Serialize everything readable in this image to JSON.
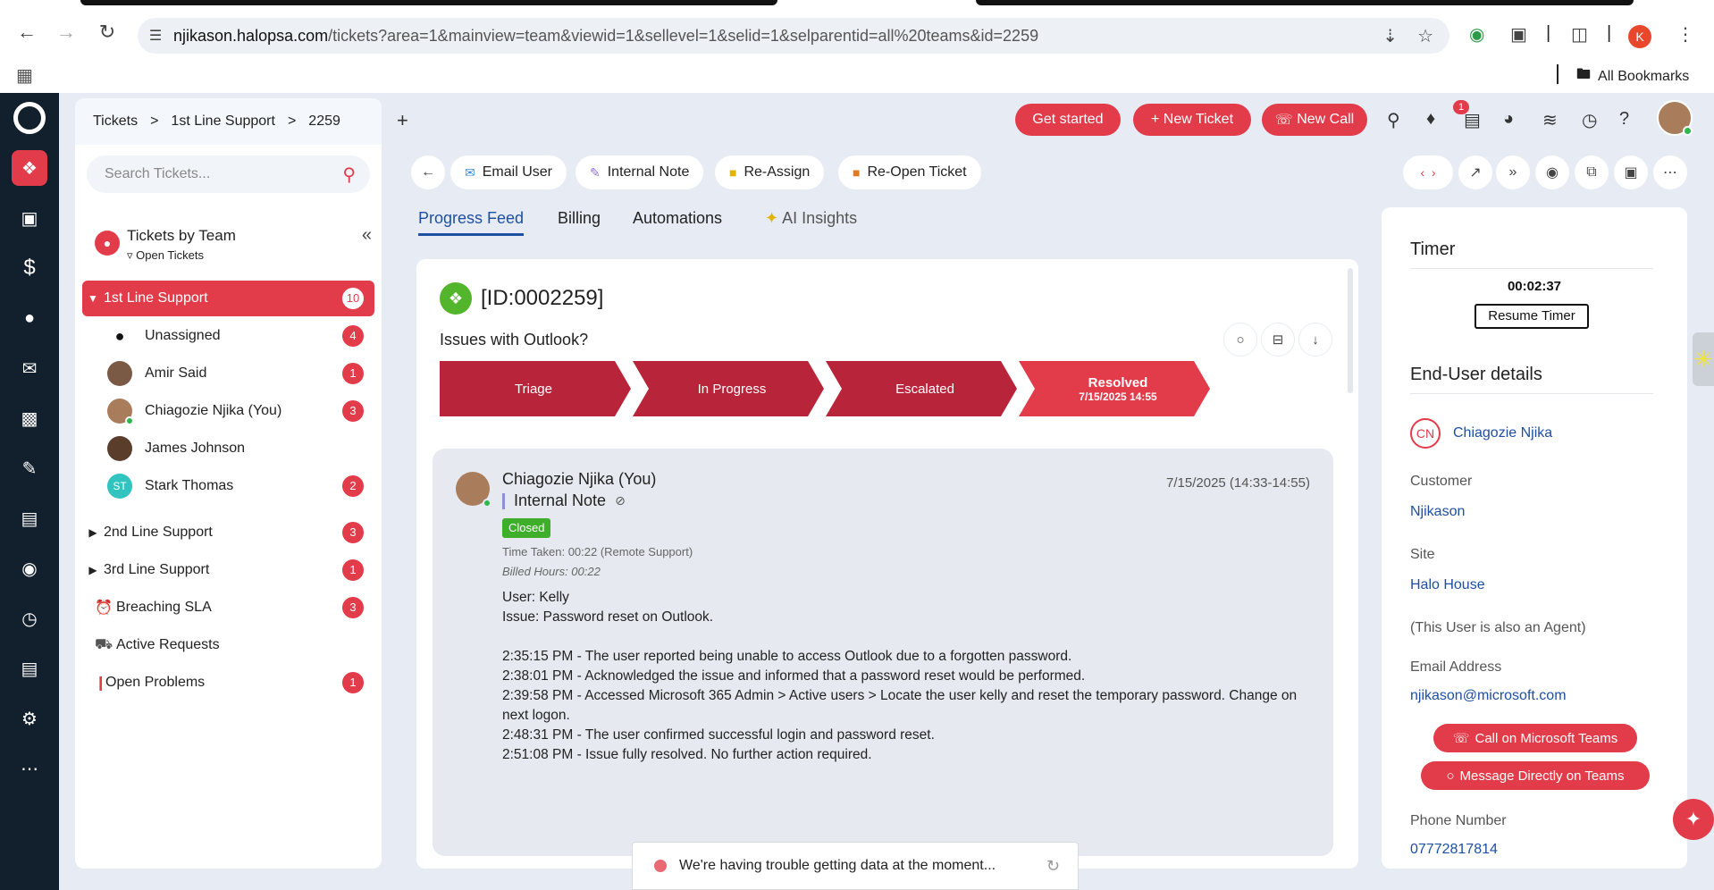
{
  "browser": {
    "url_domain": "njikason.halopsa.com",
    "url_path": "/tickets?area=1&mainview=team&viewid=1&sellevel=1&selid=1&selparentid=all%20teams&id=2259",
    "profile_initial": "K",
    "all_bookmarks": "All Bookmarks"
  },
  "breadcrumb": {
    "root": "Tickets",
    "team": "1st Line Support",
    "ticket": "2259",
    "sep": ">"
  },
  "topbar": {
    "get_started": "Get started",
    "new_ticket": "New Ticket",
    "new_call": "New Call",
    "notification_count": "1"
  },
  "sidebar": {
    "search_placeholder": "Search Tickets...",
    "view_title": "Tickets by Team",
    "view_sub": "Open Tickets",
    "teams": [
      {
        "label": "1st Line Support",
        "count": "10",
        "expanded": true
      },
      {
        "label": "2nd Line Support",
        "count": "3"
      },
      {
        "label": "3rd Line Support",
        "count": "1"
      }
    ],
    "agents": [
      {
        "label": "Unassigned",
        "count": "4"
      },
      {
        "label": "Amir Said",
        "count": "1"
      },
      {
        "label": "Chiagozie Njika (You)",
        "count": "3"
      },
      {
        "label": "James Johnson",
        "count": ""
      },
      {
        "label": "Stark Thomas",
        "count": "2",
        "initials": "ST"
      }
    ],
    "extras": [
      {
        "label": "Breaching SLA",
        "count": "3"
      },
      {
        "label": "Active Requests",
        "count": ""
      },
      {
        "label": "Open Problems",
        "count": "1"
      }
    ]
  },
  "actions": {
    "email_user": "Email User",
    "internal_note": "Internal Note",
    "reassign": "Re-Assign",
    "reopen": "Re-Open Ticket"
  },
  "tabs": {
    "progress_feed": "Progress Feed",
    "billing": "Billing",
    "automations": "Automations",
    "ai_insights": "AI Insights"
  },
  "ticket": {
    "id": "[ID:0002259]",
    "subject": "Issues with Outlook?",
    "stages": [
      {
        "label": "Triage"
      },
      {
        "label": "In Progress"
      },
      {
        "label": "Escalated"
      },
      {
        "label": "Resolved",
        "sub": "7/15/2025 14:55"
      }
    ]
  },
  "note": {
    "author": "Chiagozie Njika (You)",
    "type": "Internal Note",
    "date": "7/15/2025 (14:33-14:55)",
    "status": "Closed",
    "time_taken": "Time Taken: 00:22 (Remote Support)",
    "billed": "Billed Hours: 00:22",
    "lines": [
      "User: Kelly",
      "Issue: Password reset on Outlook.",
      "",
      "2:35:15 PM - The user reported being unable to access Outlook due to a forgotten password.",
      "2:38:01 PM - Acknowledged the issue and informed that a password reset would be performed.",
      "2:39:58 PM - Accessed Microsoft 365 Admin > Active users > Locate the user kelly and reset the temporary password. Change on next logon.",
      "2:48:31 PM - The user confirmed successful login and password reset.",
      "2:51:08 PM - Issue fully resolved. No further action required."
    ]
  },
  "right_panel": {
    "timer_title": "Timer",
    "timer_value": "00:02:37",
    "resume": "Resume Timer",
    "enduser_title": "End-User details",
    "user_initials": "CN",
    "user_name": "Chiagozie Njika",
    "customer_label": "Customer",
    "customer": "Njikason",
    "site_label": "Site",
    "site": "Halo House",
    "agent_note": "(This User is also an Agent)",
    "email_label": "Email Address",
    "email": "njikason@microsoft.com",
    "call_teams": "Call on Microsoft Teams",
    "message_teams": "Message Directly on Teams",
    "phone_label": "Phone Number",
    "phone": "07772817814"
  },
  "toast": {
    "message": "We're having trouble getting data at the moment..."
  },
  "colors": {
    "accent": "#e23b49",
    "nav_bg": "#12202d",
    "link": "#1e4fa3",
    "closed": "#3fae2a",
    "stage_done": "#b8253a"
  }
}
